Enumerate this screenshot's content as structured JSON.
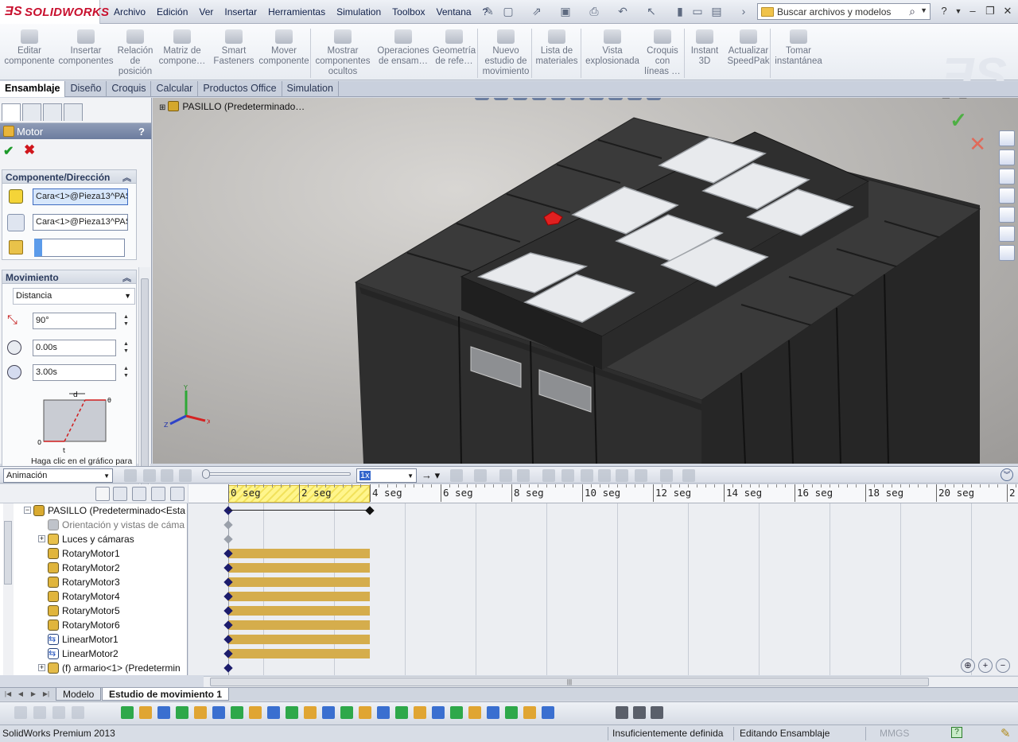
{
  "app": {
    "logo_text": "SOLIDWORKS",
    "status_product": "SolidWorks Premium 2013"
  },
  "menu": [
    "Archivo",
    "Edición",
    "Ver",
    "Insertar",
    "Herramientas",
    "Simulation",
    "Toolbox",
    "Ventana",
    "?"
  ],
  "search": {
    "placeholder": "Buscar archivos y modelos"
  },
  "ribbon": [
    {
      "label": "Editar\ncomponente",
      "icon": "edit-component-icon"
    },
    {
      "label": "Insertar\ncomponentes",
      "icon": "insert-components-icon"
    },
    {
      "label": "Relación\nde\nposición",
      "icon": "mate-icon"
    },
    {
      "label": "Matriz de\ncompone…",
      "icon": "component-pattern-icon"
    },
    {
      "label": "Smart\nFasteners",
      "icon": "smart-fasteners-icon"
    },
    {
      "label": "Mover\ncomponente",
      "icon": "move-component-icon"
    },
    {
      "label": "Mostrar\ncomponentes\nocultos",
      "icon": "show-hidden-icon"
    },
    {
      "label": "Operaciones\nde ensam…",
      "icon": "assembly-features-icon"
    },
    {
      "label": "Geometría\nde refe…",
      "icon": "reference-geometry-icon"
    },
    {
      "label": "Nuevo\nestudio de\nmovimiento",
      "icon": "new-motion-study-icon"
    },
    {
      "label": "Lista de\nmateriales",
      "icon": "bom-icon"
    },
    {
      "label": "Vista\nexplosionada",
      "icon": "exploded-view-icon"
    },
    {
      "label": "Croquis\ncon\nlíneas …",
      "icon": "explode-line-sketch-icon"
    },
    {
      "label": "Instant\n3D",
      "icon": "instant3d-icon"
    },
    {
      "label": "Actualizar\nSpeedPak",
      "icon": "speedpak-icon"
    },
    {
      "label": "Tomar\ninstantánea",
      "icon": "snapshot-icon"
    }
  ],
  "command_tabs": [
    "Ensamblaje",
    "Diseño",
    "Croquis",
    "Calcular",
    "Productos Office",
    "Simulation"
  ],
  "property_manager": {
    "title": "Motor",
    "help": "?",
    "group_direction": {
      "title": "Componente/Dirección",
      "field1": "Cara<1>@Pieza13^PASILLO",
      "field2": "Cara<1>@Pieza13^PASILLO",
      "field3": ""
    },
    "group_motion": {
      "title": "Movimiento",
      "type": "Distancia",
      "displacement": "90°",
      "start_time": "0.00s",
      "duration": "3.00s",
      "graph_hint": "Haga clic en el gráfico para"
    }
  },
  "viewport": {
    "tree_root": "PASILLO  (Predeterminado…"
  },
  "timeline": {
    "mode": "Animación",
    "speed": "1x",
    "ticks": [
      "0 seg",
      "2 seg",
      "4 seg",
      "6 seg",
      "8 seg",
      "10 seg",
      "12 seg",
      "14 seg",
      "16 seg",
      "18 seg",
      "20 seg",
      "2"
    ],
    "tree": [
      {
        "label": "PASILLO  (Predeterminado<Esta",
        "kind": "assembly",
        "indent": 0,
        "exp": "−"
      },
      {
        "label": "Orientación y vistas de cáma",
        "kind": "camera",
        "indent": 1,
        "exp": ""
      },
      {
        "label": "Luces y cámaras",
        "kind": "lights",
        "indent": 1,
        "exp": "+"
      },
      {
        "label": "RotaryMotor1",
        "kind": "rotary",
        "indent": 1,
        "exp": ""
      },
      {
        "label": "RotaryMotor2",
        "kind": "rotary",
        "indent": 1,
        "exp": ""
      },
      {
        "label": "RotaryMotor3",
        "kind": "rotary",
        "indent": 1,
        "exp": ""
      },
      {
        "label": "RotaryMotor4",
        "kind": "rotary",
        "indent": 1,
        "exp": ""
      },
      {
        "label": "RotaryMotor5",
        "kind": "rotary",
        "indent": 1,
        "exp": ""
      },
      {
        "label": "RotaryMotor6",
        "kind": "rotary",
        "indent": 1,
        "exp": ""
      },
      {
        "label": "LinearMotor1",
        "kind": "linear",
        "indent": 1,
        "exp": ""
      },
      {
        "label": "LinearMotor2",
        "kind": "linear",
        "indent": 1,
        "exp": ""
      },
      {
        "label": "(f) armario<1>  (Predetermin",
        "kind": "part",
        "indent": 1,
        "exp": "+"
      }
    ]
  },
  "sheet_tabs": [
    "Modelo",
    "Estudio de movimiento 1"
  ],
  "status": {
    "definition": "Insuficientemente definida",
    "mode": "Editando Ensamblaje",
    "units": "MMGS",
    "help": "?"
  }
}
